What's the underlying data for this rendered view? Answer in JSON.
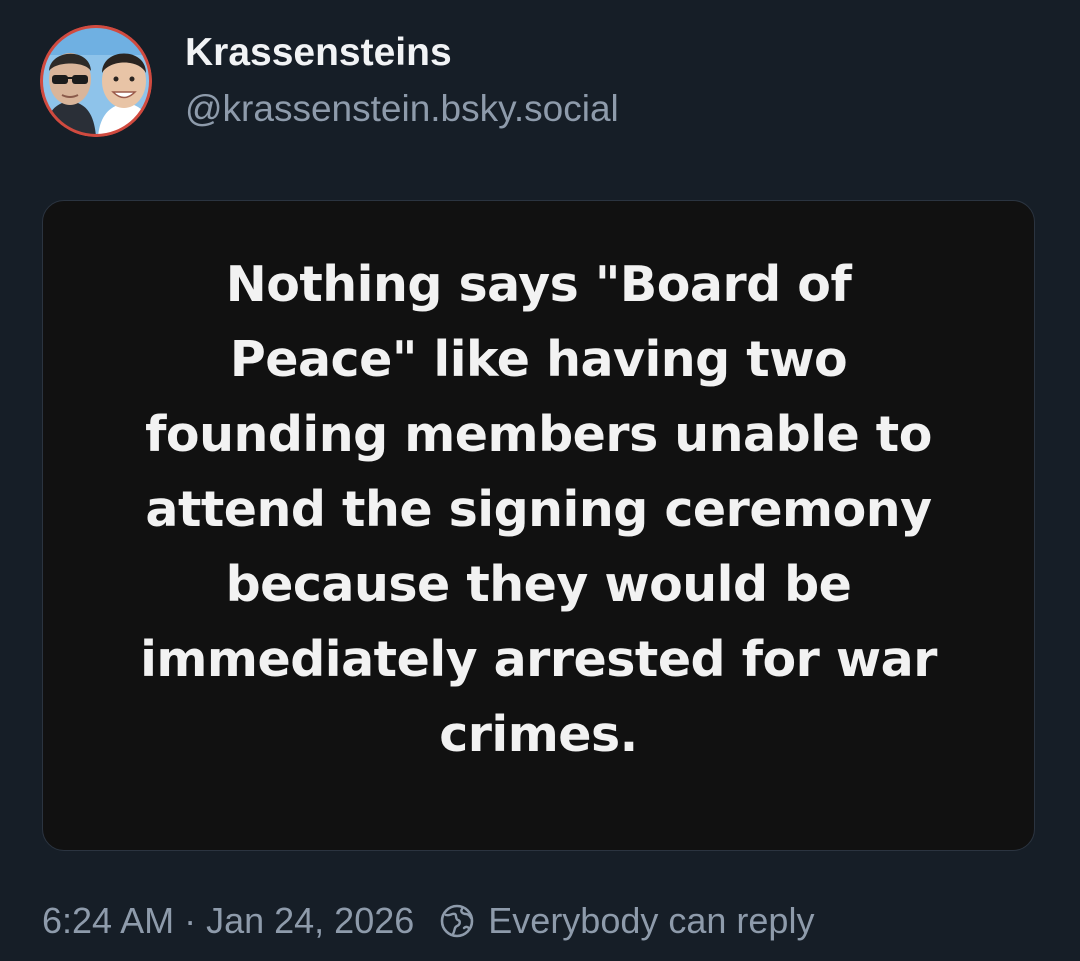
{
  "author": {
    "display_name": "Krassensteins",
    "handle": "@krassenstein.bsky.social",
    "avatar_icon": "two-person-avatar"
  },
  "embed": {
    "text": "Nothing says \"Board of Peace\" like having two founding members unable to attend the signing ceremony because they would be immediately arrested for war crimes."
  },
  "meta": {
    "time": "6:24 AM",
    "separator": "·",
    "date": "Jan 24, 2026",
    "reply_icon": "earth-globe-icon",
    "reply_setting": "Everybody can reply"
  },
  "colors": {
    "background": "#161e27",
    "muted_text": "#8e9bab",
    "image_background": "#111111"
  }
}
